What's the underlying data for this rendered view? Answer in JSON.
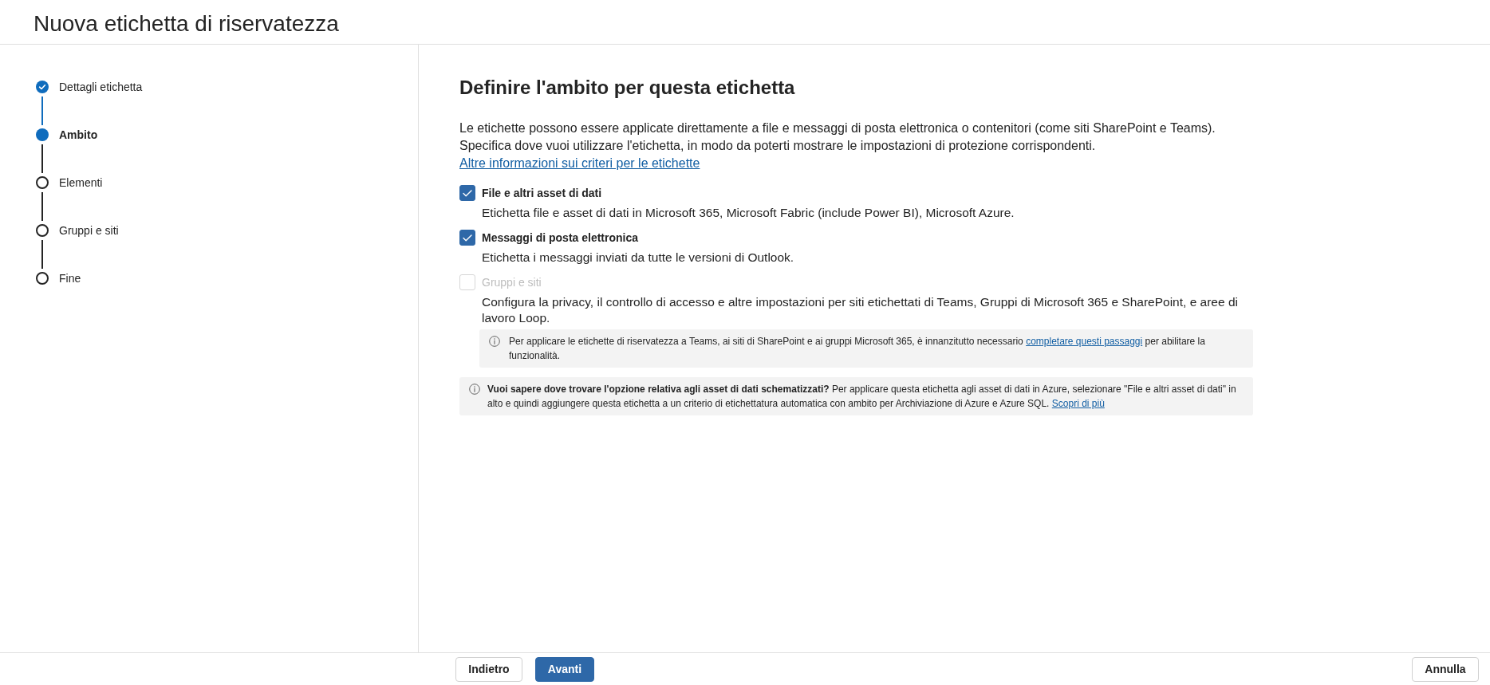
{
  "header": {
    "title": "Nuova etichetta di riservatezza"
  },
  "steps": [
    {
      "label": "Dettagli etichetta",
      "completed": true,
      "selected": false
    },
    {
      "label": "Ambito",
      "completed": false,
      "selected": true
    },
    {
      "label": "Elementi",
      "completed": false,
      "selected": false
    },
    {
      "label": "Gruppi e siti",
      "completed": false,
      "selected": false
    },
    {
      "label": "Fine",
      "completed": false,
      "selected": false
    }
  ],
  "main": {
    "heading": "Definire l'ambito per questa etichetta",
    "intro": {
      "text": "Le etichette possono essere applicate direttamente a file e messaggi di posta elettronica o contenitori (come siti SharePoint e Teams). Specifica dove vuoi utilizzare l'etichetta, in modo da poterti mostrare le impostazioni di protezione corrispondenti.",
      "link": "Altre informazioni sui criteri per le etichette"
    },
    "scopes": [
      {
        "label": "File e altri asset di dati",
        "description": "Etichetta file e asset di dati in Microsoft 365, Microsoft Fabric (include Power BI), Microsoft Azure.",
        "checked": true,
        "disabled": false
      },
      {
        "label": "Messaggi di posta elettronica",
        "description": "Etichetta i messaggi inviati da tutte le versioni di Outlook.",
        "checked": true,
        "disabled": false
      },
      {
        "label": "Gruppi e siti",
        "description": "Configura la privacy, il controllo di accesso e altre impostazioni per siti etichettati di Teams, Gruppi di Microsoft 365 e SharePoint, e aree di lavoro Loop.",
        "checked": false,
        "disabled": true,
        "note": {
          "text": "Per applicare le etichette di riservatezza a Teams, ai siti di SharePoint e ai gruppi Microsoft 365, è innanzitutto necessario",
          "link": "completare questi passaggi",
          "text_after": "per abilitare la funzionalità."
        }
      }
    ],
    "info": {
      "text": "**Vuoi sapere dove trovare l'opzione relativa agli asset di dati schematizzati?** Per applicare questa etichetta agli asset di dati in Azure, selezionare \"File e altri asset di dati\" in alto e quindi aggiungere questa etichetta a un criterio di etichettatura automatica con ambito per Archiviazione di Azure e Azure SQL.",
      "link": "Scopri di più"
    }
  },
  "footer": {
    "buttons": [
      {
        "label": "Indietro",
        "kind": "secondary"
      },
      {
        "label": "Avanti",
        "kind": "primary"
      }
    ],
    "cancel": {
      "label": "Annulla"
    }
  }
}
